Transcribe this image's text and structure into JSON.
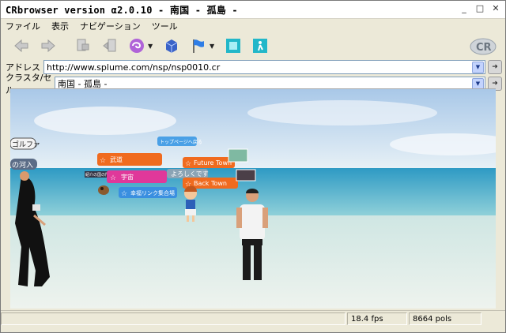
{
  "window": {
    "title": "CRbrowser version α2.0.10 - 南国 - 孤島 -"
  },
  "menu": [
    "ファイル",
    "表示",
    "ナビゲーション",
    "ツール"
  ],
  "toolbar": {
    "icons": [
      "back-icon",
      "forward-icon",
      "copy-icon",
      "paste-icon",
      "swirl-icon",
      "cube-icon",
      "flag-icon",
      "frame-icon",
      "exit-icon"
    ]
  },
  "address": {
    "label": "アドレス",
    "value": "http://www.splume.com/nsp/nsp0010.cr"
  },
  "cluster": {
    "label": "クラスタ/セル",
    "value": "南国 - 孤島 -"
  },
  "scene": {
    "signs": [
      {
        "label": "トップページへ戻る"
      },
      {
        "label": "武道"
      },
      {
        "label": "Future Town"
      },
      {
        "label": "宇宙"
      },
      {
        "label": "Back Town"
      },
      {
        "label": "幸福リンク集合場"
      }
    ],
    "chat": "よろしくです",
    "left_tabs": [
      "ゴルファ",
      "の河入"
    ],
    "small_label": "紹介の国の門"
  },
  "status": {
    "fps": "18.4 fps",
    "pols": "8664 pols"
  },
  "colors": {
    "sky_top": "#c7dcef",
    "sea": "#3aa6c8",
    "sand": "#dfe9e2",
    "sign": "#f06b1f",
    "sign_blue": "#3a8fe0"
  }
}
